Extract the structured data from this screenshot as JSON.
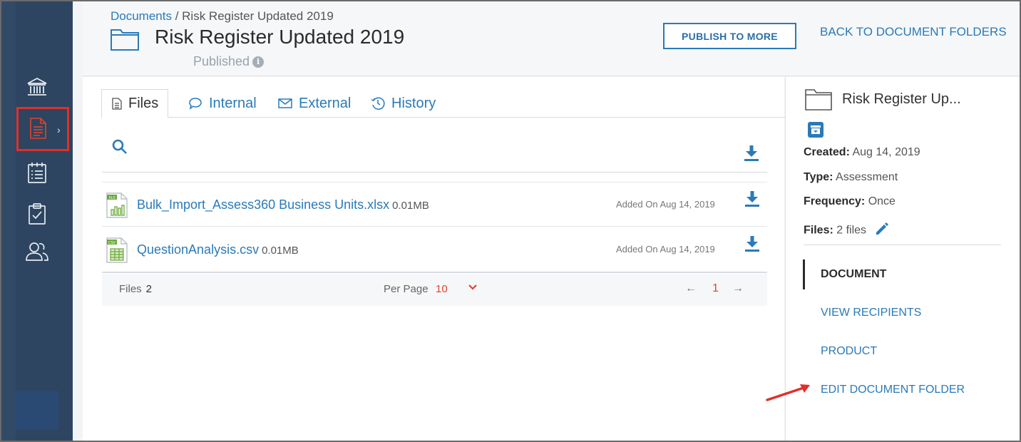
{
  "breadcrumb": {
    "root": "Documents",
    "separator": " / ",
    "current": "Risk Register Updated 2019"
  },
  "header": {
    "title": "Risk Register Updated 2019",
    "status": "Published",
    "publish_button": "PUBLISH TO MORE",
    "back_link": "BACK TO DOCUMENT FOLDERS"
  },
  "sidebar": {
    "items": [
      {
        "icon": "bank-icon"
      },
      {
        "icon": "document-icon",
        "active": true
      },
      {
        "icon": "calendar-list-icon"
      },
      {
        "icon": "clipboard-check-icon"
      },
      {
        "icon": "users-icon"
      }
    ]
  },
  "tabs": [
    {
      "label": "Files",
      "icon": "file-icon",
      "active": true
    },
    {
      "label": "Internal",
      "icon": "chat-bubble-icon"
    },
    {
      "label": "External",
      "icon": "envelope-icon"
    },
    {
      "label": "History",
      "icon": "history-icon"
    }
  ],
  "files": [
    {
      "name": "Bulk_Import_Assess360 Business Units.xlsx",
      "size": "0.01MB",
      "added": "Added On Aug 14, 2019",
      "type": "xls"
    },
    {
      "name": "QuestionAnalysis.csv",
      "size": "0.01MB",
      "added": "Added On Aug 14, 2019",
      "type": "csv"
    }
  ],
  "footer": {
    "files_label": "Files",
    "files_count": "2",
    "per_page_label": "Per Page",
    "per_page_value": "10",
    "prev": "←",
    "page": "1",
    "next": "→"
  },
  "panel": {
    "title": "Risk Register Up...",
    "created_label": "Created:",
    "created_value": "Aug 14, 2019",
    "type_label": "Type:",
    "type_value": "Assessment",
    "frequency_label": "Frequency:",
    "frequency_value": "Once",
    "files_label": "Files:",
    "files_value": "2 files",
    "menu": [
      "DOCUMENT",
      "VIEW RECIPIENTS",
      "PRODUCT",
      "EDIT DOCUMENT FOLDER"
    ]
  },
  "colors": {
    "sidebar": "#2d4560",
    "link": "#2a7ab8",
    "accent_red": "#e0302a"
  }
}
